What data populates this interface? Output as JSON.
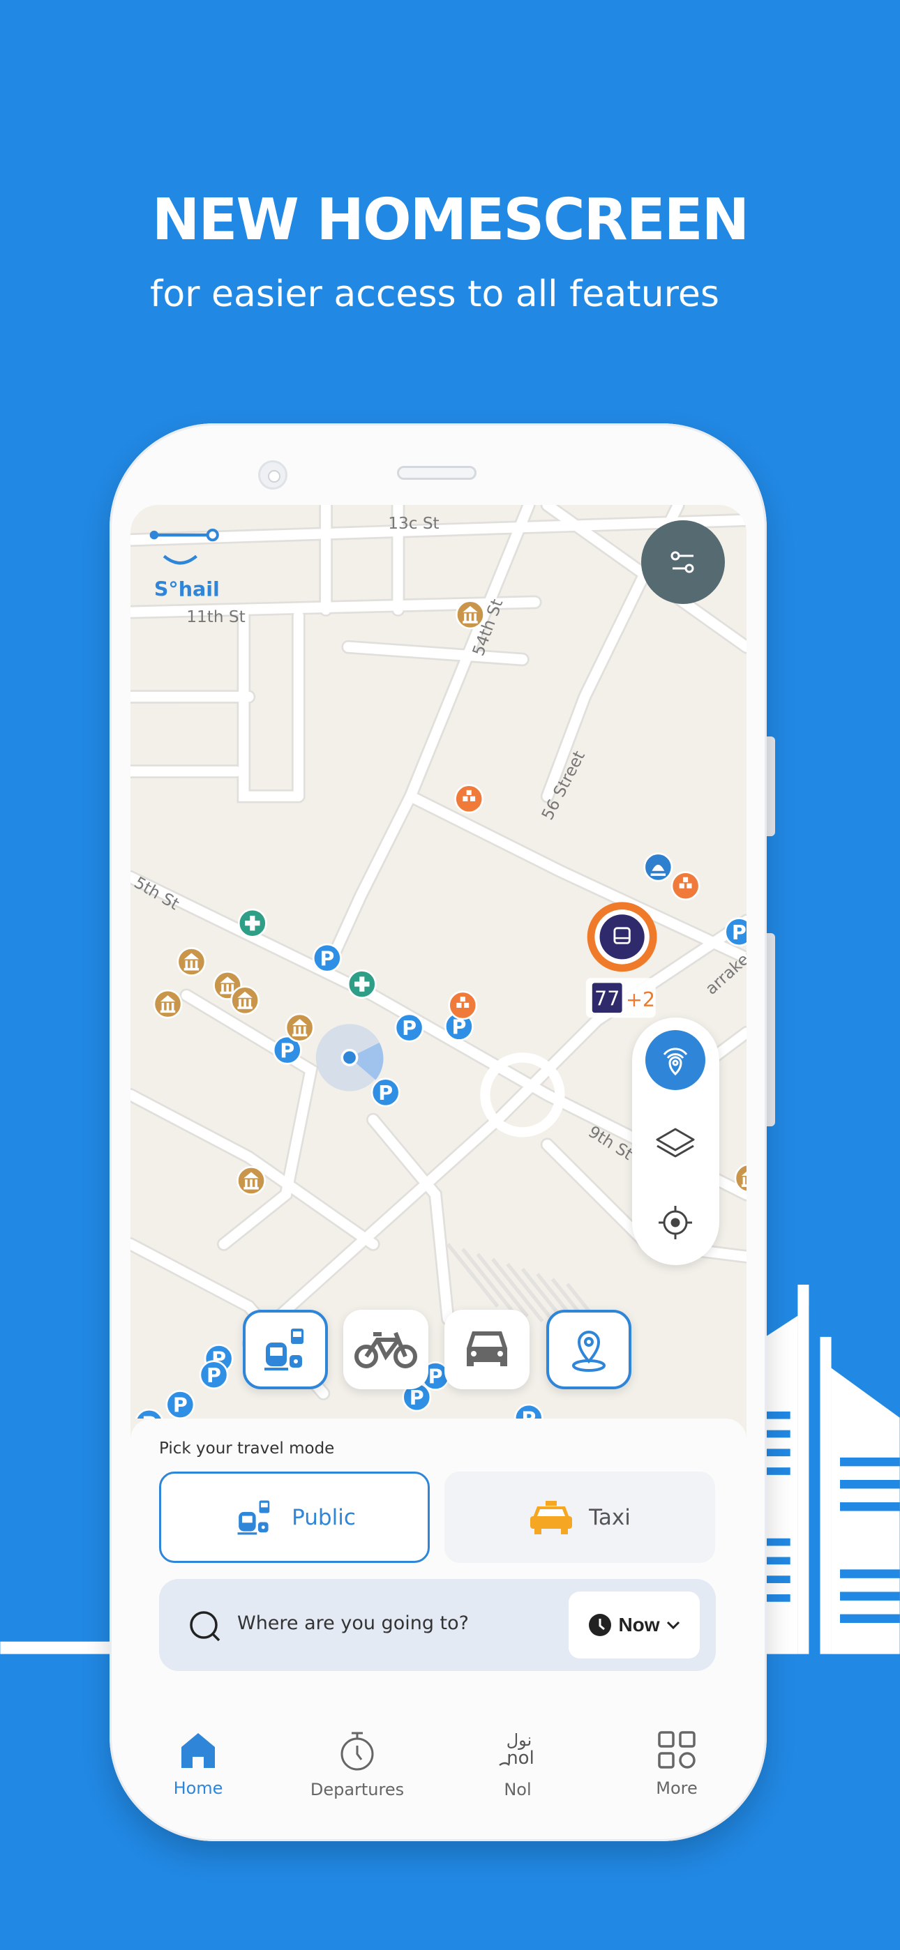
{
  "promo": {
    "title": "NEW HOMESCREEN",
    "subtitle": "for easier access to all features"
  },
  "app": {
    "logo_text": "S°hail",
    "brand_color": "#2F86D9",
    "background_color": "#2188E3"
  },
  "map": {
    "streets": [
      "13c St",
      "11th St",
      "54th St",
      "56 Street",
      "5th St",
      "9th St",
      "arrakech"
    ],
    "poi_parking_label": "P",
    "bus_route": "77",
    "bus_more": "+2",
    "filter_icon": "sliders-icon",
    "controls": [
      "nearby-signal-icon",
      "layers-icon",
      "locate-icon"
    ]
  },
  "mode_switcher": [
    {
      "icon": "public-transport-icon",
      "selected": true
    },
    {
      "icon": "bicycle-icon",
      "selected": false
    },
    {
      "icon": "car-icon",
      "selected": false
    },
    {
      "icon": "location-pin-icon",
      "selected": true
    }
  ],
  "sheet": {
    "pick_label": "Pick your travel mode",
    "modes": [
      {
        "label": "Public",
        "selected": true
      },
      {
        "label": "Taxi",
        "selected": false
      }
    ],
    "search_placeholder": "Where are you going to?",
    "time_label": "Now"
  },
  "bottom_nav": [
    {
      "label": "Home",
      "active": true
    },
    {
      "label": "Departures",
      "active": false
    },
    {
      "label": "Nol",
      "active": false,
      "logo_text": "نول nol"
    },
    {
      "label": "More",
      "active": false
    }
  ]
}
